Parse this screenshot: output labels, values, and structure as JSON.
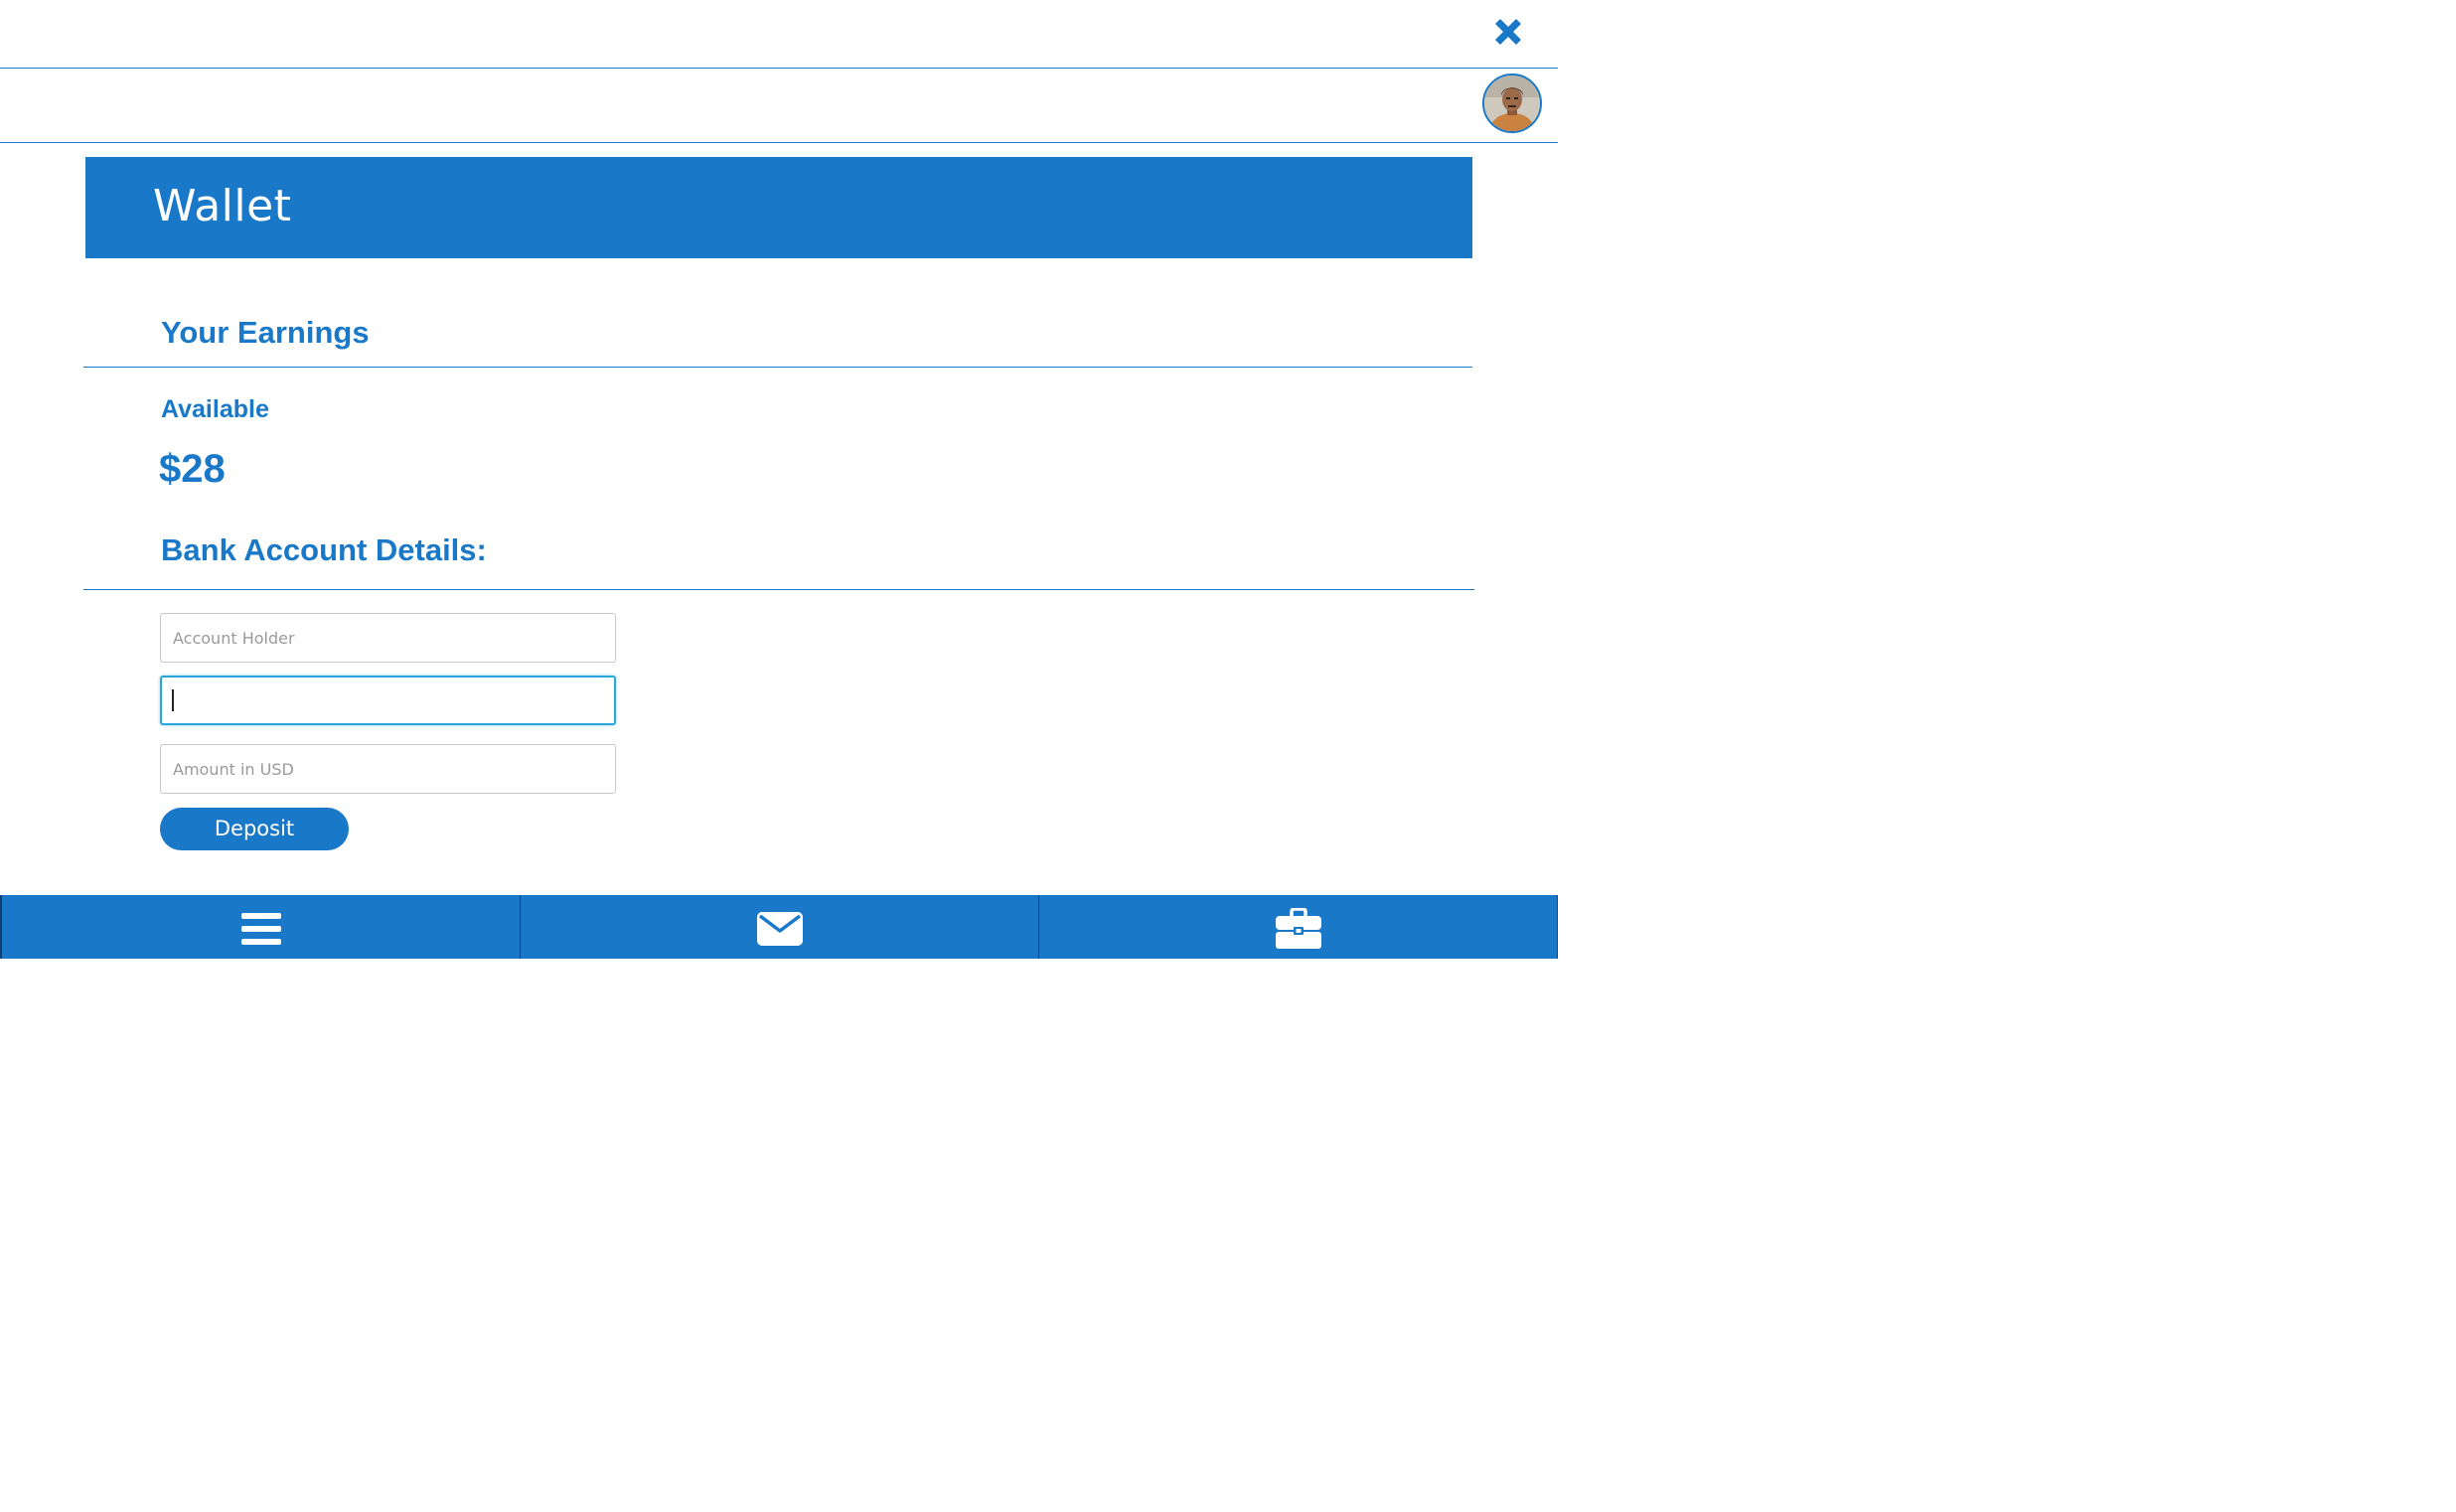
{
  "header": {
    "close_icon": "close-icon",
    "avatar_icon": "user-avatar"
  },
  "banner": {
    "title": "Wallet"
  },
  "earnings": {
    "heading": "Your Earnings",
    "available_label": "Available",
    "balance": "$28"
  },
  "bank": {
    "heading": "Bank Account Details:",
    "account_holder_placeholder": "Account Holder",
    "account_number_value": "",
    "amount_placeholder": "Amount in USD",
    "deposit_label": "Deposit"
  },
  "bottom_nav": {
    "items": [
      {
        "icon": "menu-icon"
      },
      {
        "icon": "mail-icon"
      },
      {
        "icon": "briefcase-icon"
      }
    ]
  },
  "colors": {
    "primary": "#1a78c9",
    "focus": "#2aa6dc",
    "white": "#ffffff"
  }
}
